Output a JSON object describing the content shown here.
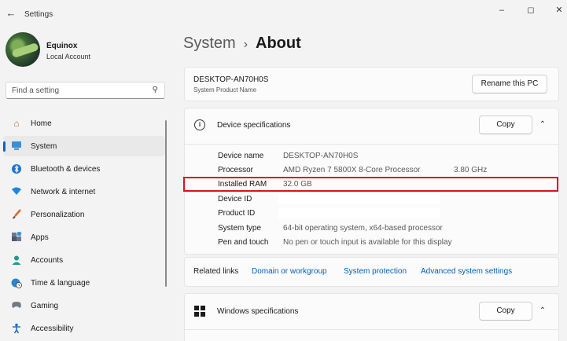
{
  "app": {
    "title": "Settings",
    "back_icon": "back-arrow-icon",
    "window_controls": [
      "minimize",
      "maximize",
      "close"
    ]
  },
  "user": {
    "name": "Equinox",
    "account_type": "Local Account"
  },
  "search": {
    "placeholder": "Find a setting",
    "icon": "search-icon"
  },
  "sidebar": {
    "items": [
      {
        "label": "Home",
        "icon": "home-icon",
        "active": false
      },
      {
        "label": "System",
        "icon": "system-icon",
        "active": true
      },
      {
        "label": "Bluetooth & devices",
        "icon": "bluetooth-icon",
        "active": false
      },
      {
        "label": "Network & internet",
        "icon": "wifi-icon",
        "active": false
      },
      {
        "label": "Personalization",
        "icon": "brush-icon",
        "active": false
      },
      {
        "label": "Apps",
        "icon": "apps-icon",
        "active": false
      },
      {
        "label": "Accounts",
        "icon": "accounts-icon",
        "active": false
      },
      {
        "label": "Time & language",
        "icon": "globe-clock-icon",
        "active": false
      },
      {
        "label": "Gaming",
        "icon": "gamepad-icon",
        "active": false
      },
      {
        "label": "Accessibility",
        "icon": "accessibility-icon",
        "active": false
      }
    ]
  },
  "breadcrumb": {
    "parent": "System",
    "separator": "›",
    "current": "About"
  },
  "device": {
    "name": "DESKTOP-AN70H0S",
    "subtitle": "System Product Name",
    "rename_label": "Rename this PC"
  },
  "device_specs": {
    "title": "Device specifications",
    "copy_label": "Copy",
    "rows": [
      {
        "label": "Device name",
        "value": "DESKTOP-AN70H0S"
      },
      {
        "label": "Processor",
        "value": "AMD Ryzen 7 5800X 8-Core Processor",
        "extra": "3.80 GHz"
      },
      {
        "label": "Installed RAM",
        "value": "32.0 GB"
      },
      {
        "label": "Device ID",
        "value": ""
      },
      {
        "label": "Product ID",
        "value": ""
      },
      {
        "label": "System type",
        "value": "64-bit operating system, x64-based processor"
      },
      {
        "label": "Pen and touch",
        "value": "No pen or touch input is available for this display"
      }
    ]
  },
  "related_links": {
    "label": "Related links",
    "links": [
      "Domain or workgroup",
      "System protection",
      "Advanced system settings"
    ]
  },
  "windows_specs": {
    "title": "Windows specifications",
    "copy_label": "Copy"
  },
  "colors": {
    "accent": "#0067c0",
    "link": "#0060b8",
    "highlight": "#e0101a"
  }
}
